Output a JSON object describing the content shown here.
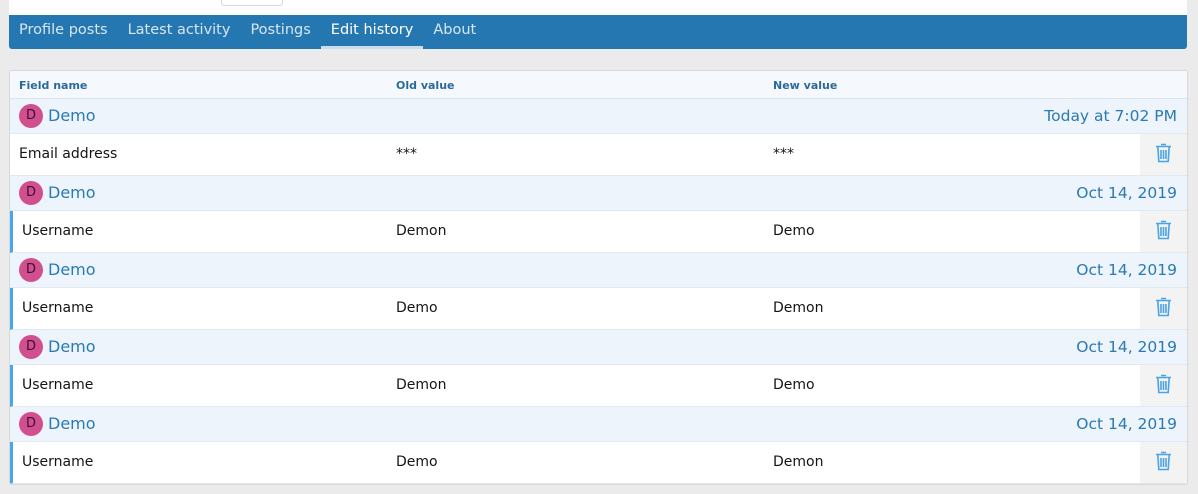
{
  "tabs": [
    {
      "label": "Profile posts",
      "active": false
    },
    {
      "label": "Latest activity",
      "active": false
    },
    {
      "label": "Postings",
      "active": false
    },
    {
      "label": "Edit history",
      "active": true
    },
    {
      "label": "About",
      "active": false
    }
  ],
  "table": {
    "headers": {
      "field": "Field name",
      "old": "Old value",
      "new": "New value"
    },
    "groups": [
      {
        "avatar": "D",
        "user": "Demo",
        "date": "Today at 7:02 PM",
        "row": {
          "field": "Email address",
          "old": "***",
          "new": "***",
          "marked": false
        }
      },
      {
        "avatar": "D",
        "user": "Demo",
        "date": "Oct 14, 2019",
        "row": {
          "field": "Username",
          "old": "Demon",
          "new": "Demo",
          "marked": true
        }
      },
      {
        "avatar": "D",
        "user": "Demo",
        "date": "Oct 14, 2019",
        "row": {
          "field": "Username",
          "old": "Demo",
          "new": "Demon",
          "marked": true
        }
      },
      {
        "avatar": "D",
        "user": "Demo",
        "date": "Oct 14, 2019",
        "row": {
          "field": "Username",
          "old": "Demon",
          "new": "Demo",
          "marked": true
        }
      },
      {
        "avatar": "D",
        "user": "Demo",
        "date": "Oct 14, 2019",
        "row": {
          "field": "Username",
          "old": "Demo",
          "new": "Demon",
          "marked": true
        }
      }
    ]
  },
  "icons": {
    "delete": "trash-icon"
  },
  "colors": {
    "nav": "#2577b1",
    "accent": "#2a7ab3",
    "avatar": "#d14f8f",
    "marker": "#47a7eb"
  }
}
